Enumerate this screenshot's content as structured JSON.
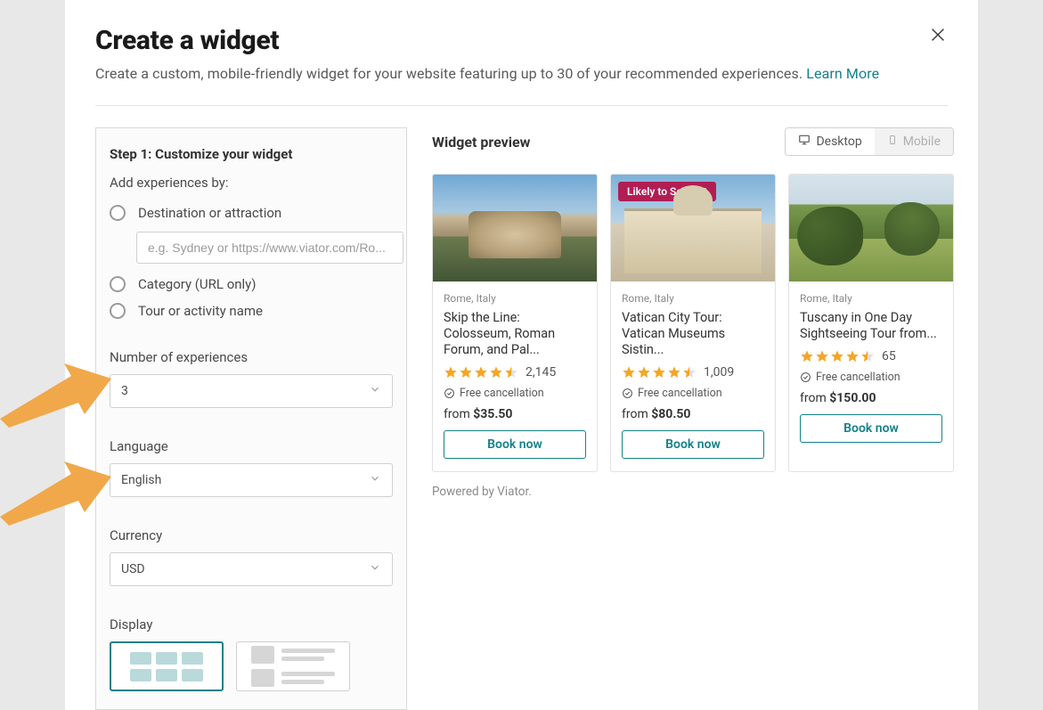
{
  "header": {
    "title": "Create a widget",
    "subtitle": "Create a custom, mobile-friendly widget for your website featuring up to 30 of your recommended experiences.",
    "learn_more": "Learn More"
  },
  "config": {
    "step_title": "Step 1: Customize your widget",
    "add_by_label": "Add experiences by:",
    "radios": {
      "destination": "Destination or attraction",
      "category": "Category (URL only)",
      "tour": "Tour or activity name"
    },
    "destination_placeholder": "e.g. Sydney or https://www.viator.com/Ro...",
    "fields": {
      "num_experiences_label": "Number of experiences",
      "num_experiences_value": "3",
      "language_label": "Language",
      "language_value": "English",
      "currency_label": "Currency",
      "currency_value": "USD",
      "display_label": "Display"
    }
  },
  "preview": {
    "title": "Widget preview",
    "device_desktop": "Desktop",
    "device_mobile": "Mobile",
    "powered": "Powered by Viator.",
    "free_cancel": "Free cancellation",
    "from_label": "from",
    "book_label": "Book now",
    "badge_sellout": "Likely to Sell Out",
    "cards": [
      {
        "location": "Rome, Italy",
        "title": "Skip the Line: Colosseum, Roman Forum, and Pal...",
        "rating_count": "2,145",
        "price": "$35.50"
      },
      {
        "location": "Rome, Italy",
        "title": "Vatican City Tour: Vatican Museums Sistin...",
        "rating_count": "1,009",
        "price": "$80.50"
      },
      {
        "location": "Rome, Italy",
        "title": "Tuscany in One Day Sightseeing Tour from...",
        "rating_count": "65",
        "price": "$150.00"
      }
    ]
  }
}
